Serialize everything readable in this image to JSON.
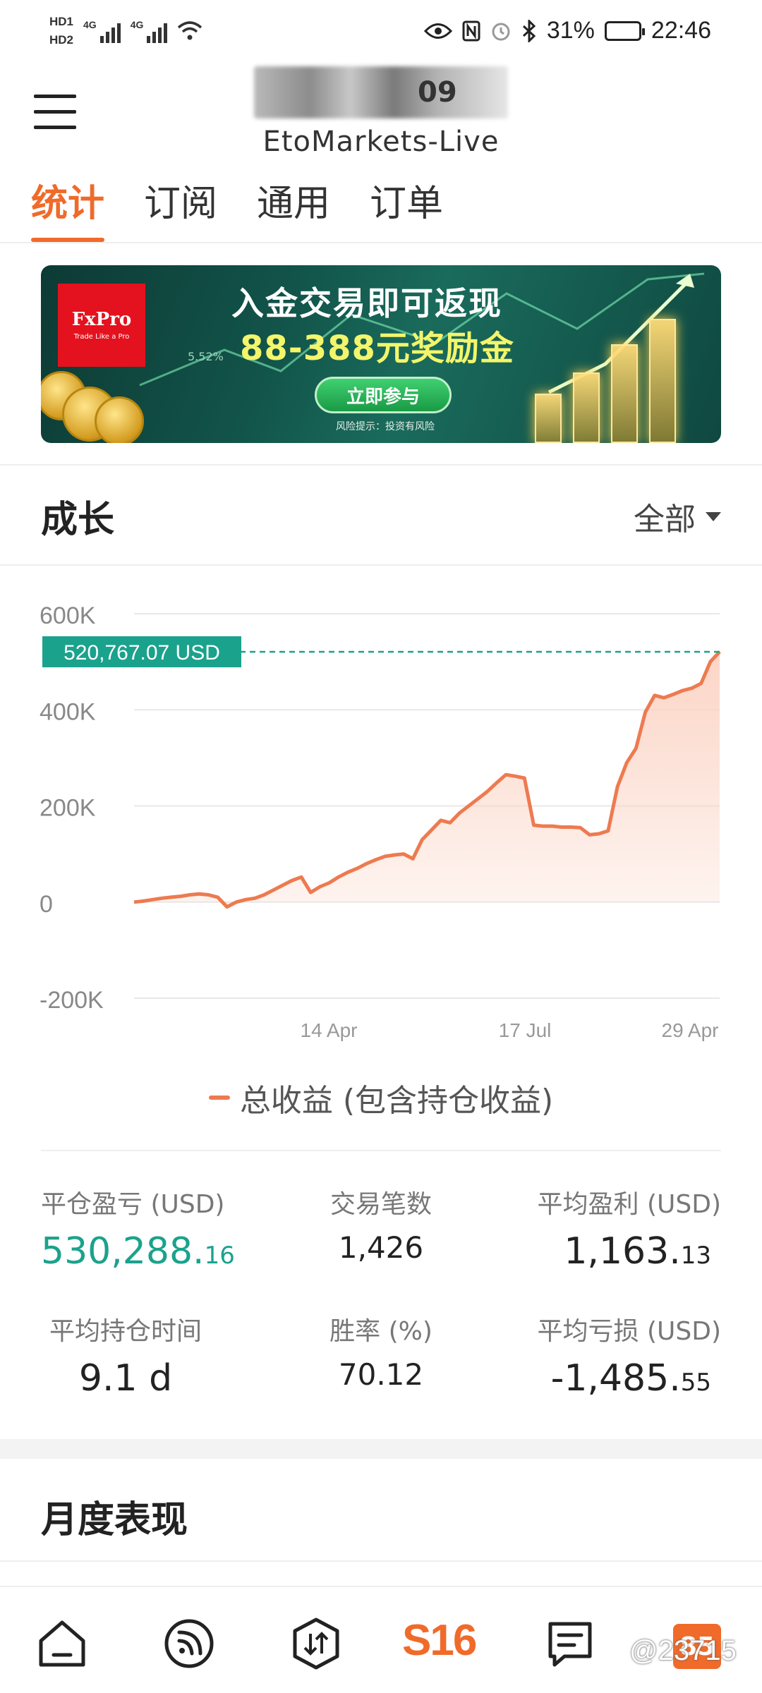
{
  "status_bar": {
    "hd1": "HD1",
    "hd2": "HD2",
    "network1": "4G",
    "network2": "4G",
    "battery": "31%",
    "time": "22:46"
  },
  "header": {
    "account_suffix": "09",
    "server": "EtoMarkets-Live"
  },
  "tabs": [
    {
      "label": "统计",
      "active": true
    },
    {
      "label": "订阅",
      "active": false
    },
    {
      "label": "通用",
      "active": false
    },
    {
      "label": "订单",
      "active": false
    }
  ],
  "banner": {
    "brand": "FxPro",
    "brand_tagline": "Trade Like a Pro",
    "headline": "入金交易即可返现",
    "subline": "88-388元奖励金",
    "button": "立即参与",
    "risk_note": "风险提示：投资有风险",
    "pct": "5.52%"
  },
  "growth": {
    "title": "成长",
    "filter": "全部"
  },
  "chart_data": {
    "type": "area",
    "title": "",
    "xlabel": "",
    "ylabel": "",
    "y_ticks": [
      "600K",
      "400K",
      "200K",
      "0",
      "-200K"
    ],
    "ylim": [
      -200000,
      600000
    ],
    "x_tick_labels": [
      "14 Apr",
      "17 Jul",
      "29 Apr"
    ],
    "current_value_label": "520,767.07 USD",
    "current_value": 520767.07,
    "series": [
      {
        "name": "总收益 (包含持仓收益)",
        "values": [
          0,
          2000,
          5000,
          8000,
          10000,
          12000,
          15000,
          17000,
          15000,
          10000,
          -10000,
          0,
          5000,
          8000,
          15000,
          25000,
          35000,
          45000,
          52000,
          20000,
          32000,
          40000,
          52000,
          62000,
          70000,
          80000,
          88000,
          95000,
          98000,
          100000,
          90000,
          130000,
          150000,
          170000,
          165000,
          185000,
          200000,
          215000,
          230000,
          248000,
          265000,
          262000,
          258000,
          160000,
          158000,
          158000,
          156000,
          156000,
          155000,
          140000,
          142000,
          148000,
          240000,
          290000,
          320000,
          395000,
          430000,
          425000,
          432000,
          440000,
          445000,
          455000,
          500000,
          520767
        ]
      }
    ],
    "grid": true,
    "legend_position": "bottom",
    "line_color": "#ee7a50",
    "fill_color": "#fbd3c3",
    "marker_color": "#1aa28c"
  },
  "stats": {
    "closed_pl_label": "平仓盈亏 (USD)",
    "closed_pl_int": "530,288.",
    "closed_pl_dec": "16",
    "trades_label": "交易笔数",
    "trades_value": "1,426",
    "avg_profit_label": "平均盈利 (USD)",
    "avg_profit_int": "1,163.",
    "avg_profit_dec": "13",
    "avg_hold_label": "平均持仓时间",
    "avg_hold_value": "9.1 d",
    "win_rate_label": "胜率 (%)",
    "win_rate_value": "70.12",
    "avg_loss_label": "平均亏损 (USD)",
    "avg_loss_int": "-1,485.",
    "avg_loss_dec": "55"
  },
  "monthly": {
    "title": "月度表现"
  },
  "bottom_nav": {
    "center_label": "S16",
    "badge": "85",
    "watermark": "@23715",
    "icons": [
      "home-icon",
      "feed-icon",
      "trade-icon",
      "s16-logo",
      "message-icon",
      "profile-badge"
    ]
  }
}
